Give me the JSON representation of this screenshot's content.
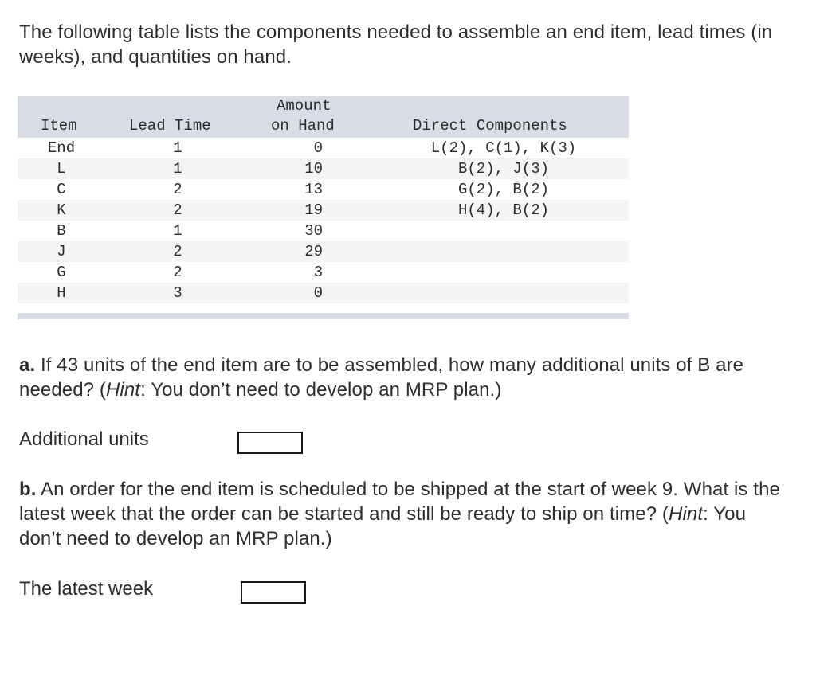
{
  "intro": "The following table lists the components needed to assemble an end item, lead times (in weeks), and quantities on hand.",
  "table": {
    "headers": {
      "item": "Item",
      "lead_time": "Lead Time",
      "amount_line1": "Amount",
      "amount_line2": "on Hand",
      "components": "Direct Components"
    },
    "rows": [
      {
        "item": "End",
        "lead_time": "1",
        "on_hand": "0",
        "components": "L(2), C(1), K(3)"
      },
      {
        "item": "L",
        "lead_time": "1",
        "on_hand": "10",
        "components": "B(2), J(3)"
      },
      {
        "item": "C",
        "lead_time": "2",
        "on_hand": "13",
        "components": "G(2), B(2)"
      },
      {
        "item": "K",
        "lead_time": "2",
        "on_hand": "19",
        "components": "H(4), B(2)"
      },
      {
        "item": "B",
        "lead_time": "1",
        "on_hand": "30",
        "components": ""
      },
      {
        "item": "J",
        "lead_time": "2",
        "on_hand": "29",
        "components": ""
      },
      {
        "item": "G",
        "lead_time": "2",
        "on_hand": "3",
        "components": ""
      },
      {
        "item": "H",
        "lead_time": "3",
        "on_hand": "0",
        "components": ""
      }
    ]
  },
  "question_a": {
    "marker": "a.",
    "text_before_hint": " If 43 units of the end item are to be assembled, how many additional units of B are needed? (",
    "hint_word": "Hint",
    "text_after_hint": ": You don’t need to develop an MRP plan.)",
    "answer_label": "Additional units",
    "answer_value": ""
  },
  "question_b": {
    "marker": "b.",
    "text_before_hint": " An order for the end item is scheduled to be shipped at the start of week 9. What is the latest week that the order can be started and still be ready to ship on time? (",
    "hint_word": "Hint",
    "text_after_hint": ": You don’t need to develop an MRP plan.)",
    "answer_label": "The latest week",
    "answer_value": ""
  },
  "colors": {
    "table_header_bg": "#d9dde6",
    "table_alt_row_bg": "#f4f4f4",
    "text": "#2d2d2d"
  }
}
